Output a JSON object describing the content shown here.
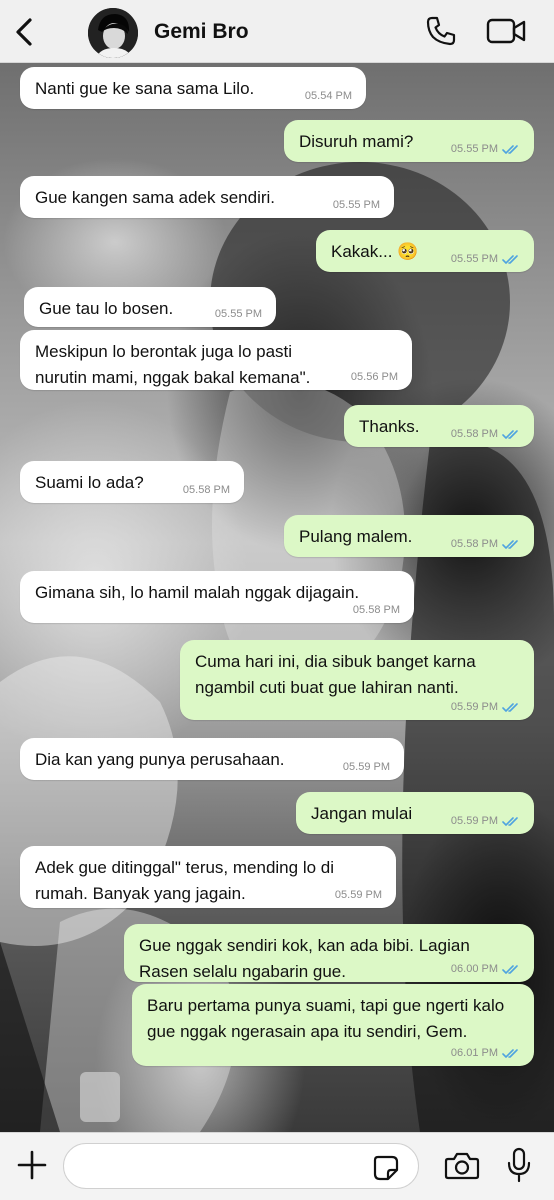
{
  "header": {
    "contact_name": "Gemi Bro",
    "icons": [
      "chevron-left-icon",
      "avatar",
      "phone-icon",
      "video-camera-icon"
    ]
  },
  "messages": [
    {
      "dir": "in",
      "text": "Nanti gue ke sana sama Lilo.",
      "time": "05.54 PM"
    },
    {
      "dir": "out",
      "text": "Disuruh mami?",
      "time": "05.55 PM",
      "read": true
    },
    {
      "dir": "in",
      "text": "Gue kangen sama adek sendiri.",
      "time": "05.55 PM"
    },
    {
      "dir": "out",
      "text": "Kakak... 🥺",
      "time": "05.55 PM",
      "read": true
    },
    {
      "dir": "in",
      "text": "Gue tau lo bosen.",
      "time": "05.55 PM"
    },
    {
      "dir": "in",
      "text": "Meskipun lo berontak juga lo pasti nurutin mami, nggak bakal kemana\".",
      "time": "05.56 PM"
    },
    {
      "dir": "out",
      "text": "Thanks.",
      "time": "05.58 PM",
      "read": true
    },
    {
      "dir": "in",
      "text": "Suami lo ada?",
      "time": "05.58 PM"
    },
    {
      "dir": "out",
      "text": "Pulang malem.",
      "time": "05.58 PM",
      "read": true
    },
    {
      "dir": "in",
      "text": "Gimana sih, lo hamil malah nggak dijagain.",
      "time": "05.58 PM"
    },
    {
      "dir": "out",
      "text": "Cuma hari ini, dia sibuk banget karna ngambil cuti buat gue lahiran nanti.",
      "time": "05.59 PM",
      "read": true
    },
    {
      "dir": "in",
      "text": "Dia kan yang punya perusahaan.",
      "time": "05.59 PM"
    },
    {
      "dir": "out",
      "text": "Jangan mulai",
      "time": "05.59 PM",
      "read": true
    },
    {
      "dir": "in",
      "text": "Adek gue ditinggal\" terus, mending lo di rumah. Banyak yang jagain.",
      "time": "05.59 PM"
    },
    {
      "dir": "out",
      "text": "Gue nggak sendiri kok, kan ada bibi. Lagian Rasen selalu ngabarin gue.",
      "time": "06.00 PM",
      "read": true
    },
    {
      "dir": "out",
      "text": "Baru pertama punya suami, tapi gue ngerti kalo gue nggak ngerasain apa itu sendiri, Gem.",
      "time": "06.01 PM",
      "read": true
    }
  ],
  "input_bar": {
    "placeholder": "",
    "icons": [
      "plus-icon",
      "sticker-icon",
      "camera-icon",
      "microphone-icon"
    ]
  },
  "colors": {
    "incoming_bubble": "#ffffff",
    "outgoing_bubble": "#dcf8c6",
    "read_tick": "#4fa3e0",
    "timestamp": "#8c8c8c"
  }
}
